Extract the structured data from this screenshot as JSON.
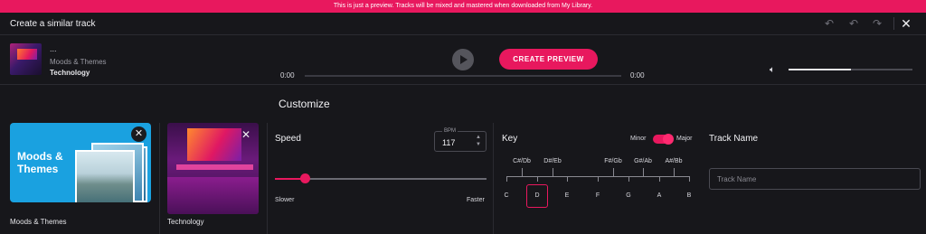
{
  "banner": {
    "text": "This is just a preview. Tracks will be mixed and mastered when downloaded from My Library."
  },
  "header": {
    "title": "Create a similar track",
    "icons": [
      "undo-icon",
      "undo-icon",
      "redo-icon",
      "close-icon"
    ]
  },
  "player": {
    "track_title": "...",
    "track_category": "Moods & Themes",
    "track_genre": "Technology",
    "create_label": "CREATE PREVIEW",
    "time_start": "0:00",
    "time_end": "0:00",
    "progress": 0,
    "volume": 0.5
  },
  "customize": {
    "heading": "Customize",
    "cards": [
      {
        "title": "Moods & Themes",
        "label": "Moods & Themes"
      },
      {
        "label": "Technology"
      }
    ]
  },
  "speed": {
    "label": "Speed",
    "bpm_label": "BPM",
    "bpm_value": "117",
    "slider_value": 0.14,
    "slower_label": "Slower",
    "faster_label": "Faster"
  },
  "key": {
    "label": "Key",
    "minor_label": "Minor",
    "major_label": "Major",
    "mode": "Major",
    "sharps": [
      "C#/Db",
      "D#/Eb",
      "F#/Gb",
      "G#/Ab",
      "A#/Bb"
    ],
    "naturals": [
      "C",
      "D",
      "E",
      "F",
      "G",
      "A",
      "B"
    ],
    "selected": "D"
  },
  "track_name": {
    "label": "Track Name",
    "placeholder": "Track Name",
    "value": ""
  },
  "colors": {
    "accent": "#e8185e",
    "background": "#17171b"
  }
}
